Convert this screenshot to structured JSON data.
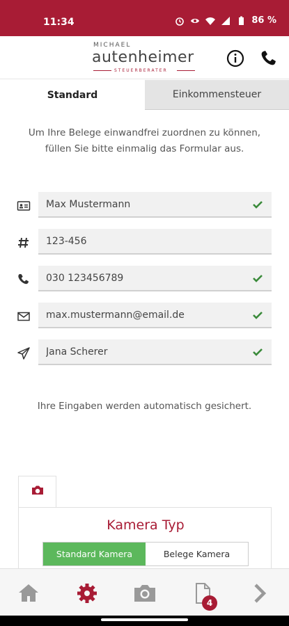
{
  "status_bar": {
    "time": "11:34",
    "battery": "86 %"
  },
  "header": {
    "logo_top": "MICHAEL",
    "logo_main": "autenheimer",
    "logo_sub": "STEUERBERATER"
  },
  "tabs": [
    {
      "label": "Standard"
    },
    {
      "label": "Einkommensteuer"
    }
  ],
  "intro_text": "Um Ihre Belege einwandfrei zuordnen zu können, füllen Sie bitte einmalig das Formular aus.",
  "fields": [
    {
      "icon": "id-card-icon",
      "value": "Max Mustermann",
      "valid": true
    },
    {
      "icon": "hash-icon",
      "value": "123-456",
      "valid": false
    },
    {
      "icon": "phone-icon",
      "value": "030 123456789",
      "valid": true
    },
    {
      "icon": "mail-icon",
      "value": "max.mustermann@email.de",
      "valid": true
    },
    {
      "icon": "send-icon",
      "value": "Jana Scherer",
      "valid": true
    }
  ],
  "autosave_text": "Ihre Eingaben werden automatisch gesichert.",
  "camera": {
    "title": "Kamera Typ",
    "options": [
      {
        "label": "Standard Kamera",
        "selected": true
      },
      {
        "label": "Belege Kamera",
        "selected": false
      }
    ]
  },
  "bottom_nav": {
    "documents_badge": "4"
  },
  "colors": {
    "brand": "#a81c35",
    "check": "#3a8a3a",
    "selected": "#5cb85c"
  }
}
